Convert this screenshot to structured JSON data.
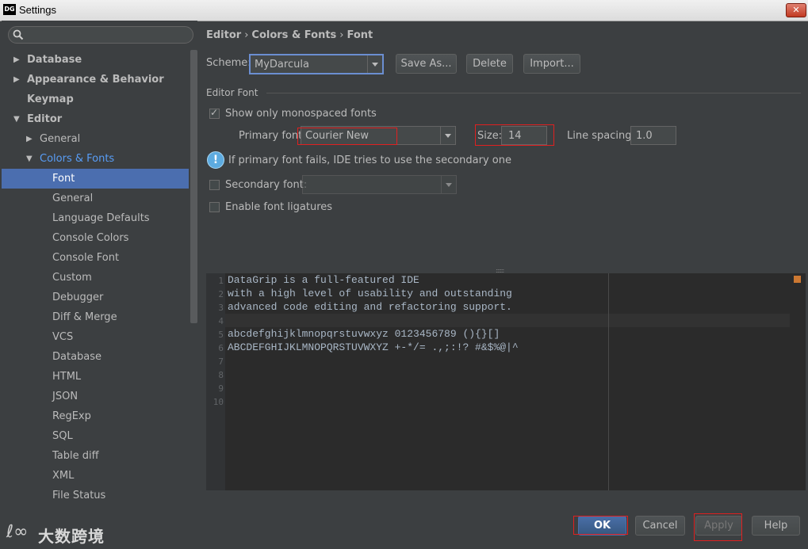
{
  "window": {
    "title": "Settings",
    "app_icon": "DG",
    "close_label": "✕"
  },
  "sidebar": {
    "search_placeholder": "",
    "items": [
      {
        "label": "Database",
        "level": 0,
        "arrow": "▶",
        "bold": true
      },
      {
        "label": "Appearance & Behavior",
        "level": 0,
        "arrow": "▶",
        "bold": true
      },
      {
        "label": "Keymap",
        "level": 0,
        "arrow": "",
        "bold": true
      },
      {
        "label": "Editor",
        "level": 0,
        "arrow": "▼",
        "bold": true
      },
      {
        "label": "General",
        "level": 1,
        "arrow": "▶"
      },
      {
        "label": "Colors & Fonts",
        "level": 1,
        "arrow": "▼",
        "link": true
      },
      {
        "label": "Font",
        "level": 2,
        "selected": true
      },
      {
        "label": "General",
        "level": 2
      },
      {
        "label": "Language Defaults",
        "level": 2
      },
      {
        "label": "Console Colors",
        "level": 2
      },
      {
        "label": "Console Font",
        "level": 2
      },
      {
        "label": "Custom",
        "level": 2
      },
      {
        "label": "Debugger",
        "level": 2
      },
      {
        "label": "Diff & Merge",
        "level": 2
      },
      {
        "label": "VCS",
        "level": 2
      },
      {
        "label": "Database",
        "level": 2
      },
      {
        "label": "HTML",
        "level": 2
      },
      {
        "label": "JSON",
        "level": 2
      },
      {
        "label": "RegExp",
        "level": 2
      },
      {
        "label": "SQL",
        "level": 2
      },
      {
        "label": "Table diff",
        "level": 2
      },
      {
        "label": "XML",
        "level": 2
      },
      {
        "label": "File Status",
        "level": 2
      }
    ]
  },
  "breadcrumb": {
    "part1": "Editor",
    "part2": "Colors & Fonts",
    "part3": "Font",
    "sep": "›"
  },
  "scheme": {
    "label": "Scheme:",
    "value": "MyDarcula",
    "save_as": "Save As...",
    "delete": "Delete",
    "import": "Import..."
  },
  "editor_font": {
    "section_title": "Editor Font",
    "show_mono_label": "Show only monospaced fonts",
    "primary_font_label": "Primary font",
    "primary_font_value": "Courier New",
    "size_label": "Size:",
    "size_value": "14",
    "line_spacing_label": "Line spacing:",
    "line_spacing_value": "1.0",
    "info_text": "If primary font fails, IDE tries to use the secondary one",
    "secondary_font_label": "Secondary font:",
    "secondary_font_value": "",
    "ligatures_label": "Enable font ligatures"
  },
  "preview": {
    "splitter": "::::::",
    "line_numbers": [
      "1",
      "2",
      "3",
      "4",
      "5",
      "6",
      "7",
      "8",
      "9",
      "10"
    ],
    "lines": [
      "DataGrip is a full-featured IDE",
      "with a high level of usability and outstanding",
      "advanced code editing and refactoring support.",
      "",
      "abcdefghijklmnopqrstuvwxyz 0123456789 (){}[]",
      "ABCDEFGHIJKLMNOPQRSTUVWXYZ +-*/= .,;:!? #&$%@|^",
      "",
      "",
      "",
      ""
    ]
  },
  "buttons": {
    "ok": "OK",
    "cancel": "Cancel",
    "apply": "Apply",
    "help": "Help"
  },
  "watermark": {
    "logo": "ℓ∞",
    "text": "大数跨境"
  },
  "colors": {
    "selection": "#4b6eaf",
    "link": "#589df6",
    "highlight_border": "#e02020",
    "background": "#3c3f41"
  }
}
